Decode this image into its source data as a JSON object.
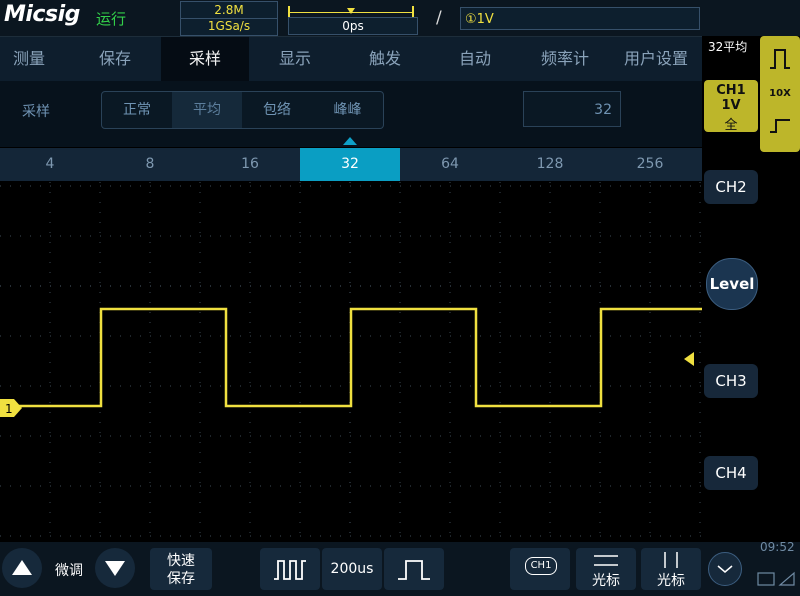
{
  "top": {
    "brand": "Micsig",
    "run_status": "运行",
    "memory_depth": "2.8M",
    "sample_rate": "1GSa/s",
    "time_position": "0ps",
    "trigger_slope": "/",
    "trigger_info": "①1V"
  },
  "menu": {
    "items": [
      "测量",
      "保存",
      "采样",
      "显示",
      "触发",
      "自动",
      "频率计",
      "用户设置"
    ],
    "active_index": 2
  },
  "sampling": {
    "label": "采样",
    "modes": [
      "正常",
      "平均",
      "包络",
      "峰峰"
    ],
    "active_mode_index": 1,
    "average_count": "32"
  },
  "average_counts": {
    "values": [
      "4",
      "8",
      "16",
      "32",
      "64",
      "128",
      "256"
    ],
    "active_index": 3
  },
  "right_panel": {
    "avg_status": "32平均",
    "ch1": {
      "name": "CH1",
      "scale": "1V",
      "coupling": "全"
    },
    "probe": "10X",
    "ch2": "CH2",
    "level": "Level",
    "ch3": "CH3",
    "ch4": "CH4"
  },
  "waveform": {
    "channel_marker": "1",
    "color": "#f0e040"
  },
  "bottom": {
    "fine_label": "微调",
    "quick_save_line1": "快速",
    "quick_save_line2": "保存",
    "timebase": "200us",
    "ch_button": "CH1",
    "cursor1": "光标",
    "cursor2": "光标",
    "clock": "09:52"
  },
  "colors": {
    "accent": "#0a9ec3",
    "trace": "#f0e040",
    "badge": "#bdb62a",
    "run": "#33d04a"
  }
}
